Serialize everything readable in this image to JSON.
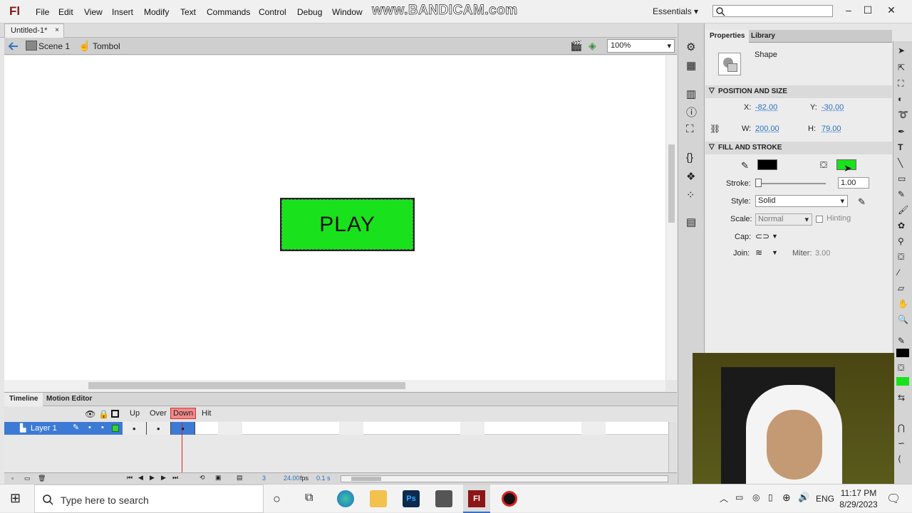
{
  "app": {
    "logo": "Fl"
  },
  "menu": [
    "File",
    "Edit",
    "View",
    "Insert",
    "Modify",
    "Text",
    "Commands",
    "Control",
    "Debug",
    "Window"
  ],
  "watermark": "www.BANDICAM.com",
  "workspace": "Essentials",
  "document": {
    "tab_title": "Untitled-1*",
    "close": "×"
  },
  "editbar": {
    "scene": "Scene 1",
    "symbol": "Tombol",
    "zoom": "100%"
  },
  "stage": {
    "button_text": "PLAY",
    "button_color": "#19e21c"
  },
  "timeline": {
    "tabs": [
      "Timeline",
      "Motion Editor"
    ],
    "states": [
      "Up",
      "Over",
      "Down",
      "Hit"
    ],
    "layer": "Layer 1",
    "current_frame": "3",
    "fps": "24.00",
    "fps_unit": "fps",
    "time": "0.1 s"
  },
  "properties": {
    "tabs": [
      "Properties",
      "Library"
    ],
    "type": "Shape",
    "position_size": {
      "header": "POSITION AND SIZE",
      "x_label": "X:",
      "x": "-82.00",
      "y_label": "Y:",
      "y": "-30.00",
      "w_label": "W:",
      "w": "200.00",
      "h_label": "H:",
      "h": "79.00"
    },
    "fill_stroke": {
      "header": "FILL AND STROKE",
      "stroke_color": "#000000",
      "fill_color": "#19e21c",
      "stroke_label": "Stroke:",
      "stroke_value": "1.00",
      "style_label": "Style:",
      "style_value": "Solid",
      "scale_label": "Scale:",
      "scale_value": "Normal",
      "hinting_label": "Hinting",
      "cap_label": "Cap:",
      "join_label": "Join:",
      "miter_label": "Miter:",
      "miter_value": "3.00"
    }
  },
  "taskbar": {
    "search_placeholder": "Type here to search",
    "lang": "ENG",
    "time": "11:17 PM",
    "date": "8/29/2023"
  }
}
